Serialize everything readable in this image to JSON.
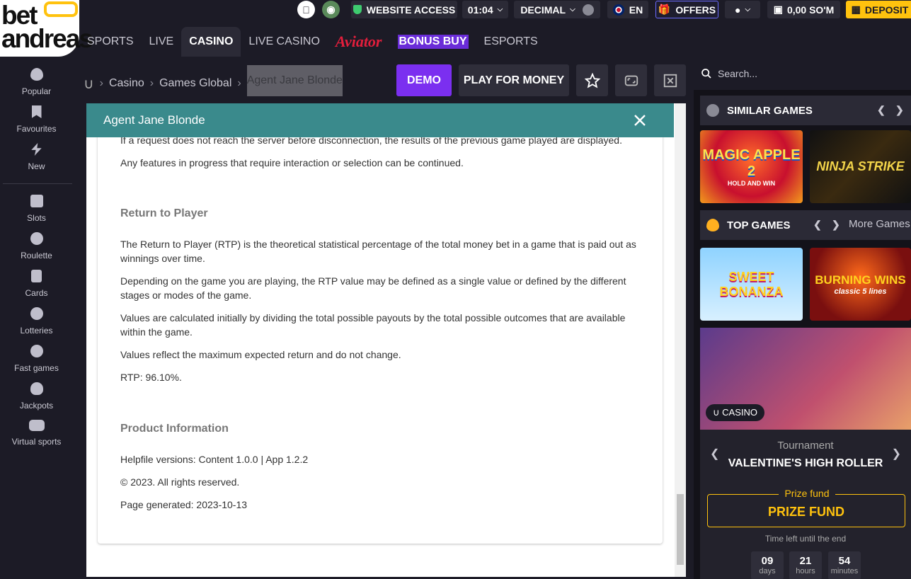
{
  "brand": {
    "line1": "bet",
    "line2": "andreas",
    "accent": "#ffc20e"
  },
  "topbar": {
    "website_access": "WEBSITE ACCESS",
    "time": "01:04",
    "odds_format": "DECIMAL",
    "language": "EN",
    "offers": "OFFERS",
    "balance": "0,00 SO'M",
    "deposit": "DEPOSIT"
  },
  "nav": {
    "sports": "SPORTS",
    "live": "LIVE",
    "casino": "CASINO",
    "live_casino": "LIVE CASINO",
    "aviator": "Aviator",
    "bonus_buy": "BONUS BUY",
    "esports": "ESPORTS"
  },
  "sidebar": {
    "items": [
      "Popular",
      "Favourites",
      "New",
      "Slots",
      "Roulette",
      "Cards",
      "Lotteries",
      "Fast games",
      "Jackpots",
      "Virtual sports"
    ]
  },
  "breadcrumb": {
    "casino": "Casino",
    "provider": "Games Global",
    "game": "Agent Jane Blonde"
  },
  "actions": {
    "demo": "DEMO",
    "play": "PLAY FOR MONEY"
  },
  "modal": {
    "title": "Agent Jane Blonde",
    "p1": "If a request does not reach the server before disconnection, the results of the previous game played are displayed.",
    "p2": "Any features in progress that require interaction or selection can be continued.",
    "h_rtp": "Return to Player",
    "p3a": "The Return to Player (RTP) is the theoretical statistical percentage of the total money bet in a game that is paid out as",
    "p3b": "winnings over time.",
    "p4a": "Depending on the game you are playing, the RTP value may be defined as a single value or defined by the different",
    "p4b": "stages or modes of the game.",
    "p5a": "Values are calculated initially by dividing the total possible payouts by the total possible outcomes that are available",
    "p5b": "within the game.",
    "p6": "Values reflect the maximum expected return and do not change.",
    "p7": "RTP: 96.10%.",
    "h_prod": "Product Information",
    "p8": "Helpfile versions: Content 1.0.0 | App 1.2.2",
    "p9": "© 2023. All rights reserved.",
    "p10": "Page generated: 2023-10-13"
  },
  "right": {
    "search_placeholder": "Search...",
    "similar": "SIMILAR GAMES",
    "top": "TOP GAMES",
    "more": "More Games",
    "tiles": [
      "MAGIC APPLE 2",
      "NINJA STRIKE",
      "SWEET BONANZA",
      "BURNING WINS"
    ],
    "tile_sub": [
      "HOLD AND WIN",
      "",
      "",
      "classic 5 lines"
    ],
    "promo_badge": "CASINO",
    "tournament": "Tournament",
    "tournament_name": "VALENTINE'S HIGH ROLLER",
    "prize_caption": "Prize fund",
    "prize_value": "PRIZE FUND",
    "time_left": "Time left until the end",
    "countdown": [
      {
        "n": "09",
        "l": "days"
      },
      {
        "n": "21",
        "l": "hours"
      },
      {
        "n": "54",
        "l": "minutes"
      }
    ]
  }
}
